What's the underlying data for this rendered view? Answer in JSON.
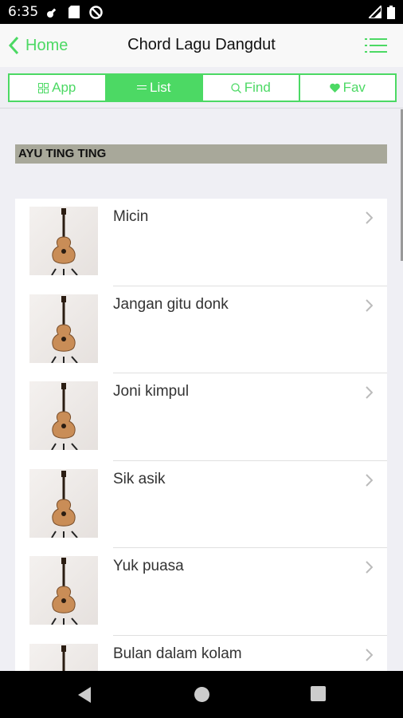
{
  "status_bar": {
    "time": "6:35"
  },
  "header": {
    "back_label": "Home",
    "title": "Chord Lagu Dangdut"
  },
  "segments": [
    {
      "label": "App",
      "icon": "grid-icon",
      "active": false
    },
    {
      "label": "List",
      "icon": "list-icon",
      "active": true
    },
    {
      "label": "Find",
      "icon": "search-icon",
      "active": false
    },
    {
      "label": "Fav",
      "icon": "heart-icon",
      "active": false
    }
  ],
  "section": {
    "title": "AYU TING TING"
  },
  "songs": [
    {
      "title": "Micin"
    },
    {
      "title": "Jangan gitu donk"
    },
    {
      "title": "Joni kimpul"
    },
    {
      "title": "Sik asik"
    },
    {
      "title": "Yuk puasa"
    },
    {
      "title": "Bulan dalam kolam"
    }
  ],
  "colors": {
    "accent": "#4cd964",
    "section_bg": "#a8a89a",
    "page_bg": "#efeff4"
  }
}
